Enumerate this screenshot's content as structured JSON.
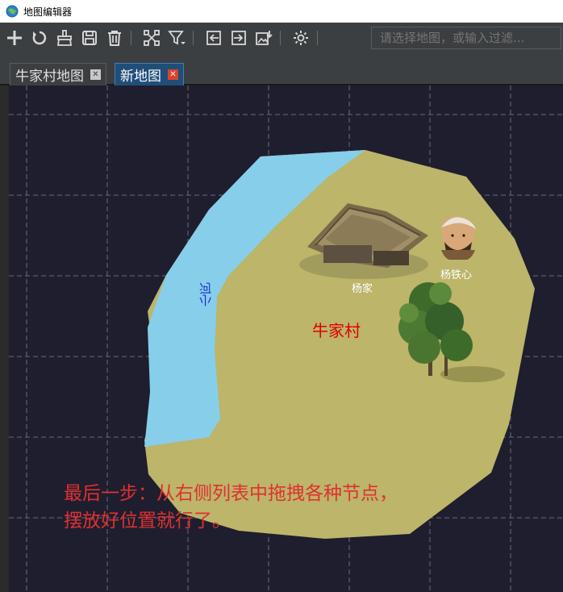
{
  "window": {
    "title": "地图编辑器"
  },
  "toolbar": {
    "search_placeholder": "请选择地图，或输入过滤..."
  },
  "tabs": [
    {
      "label": "牛家村地图",
      "active": false
    },
    {
      "label": "新地图",
      "active": true
    }
  ],
  "map": {
    "river_label": "小河",
    "village_label": "牛家村",
    "house_label": "杨家",
    "npc_label": "杨铁心"
  },
  "annotation": {
    "line1": "最后一步：从右侧列表中拖拽各种节点，",
    "line2": "摆放好位置就行了。"
  },
  "colors": {
    "land": "#bcb56a",
    "river": "#87ceeb",
    "annotation": "#e03030",
    "village_label": "#e00000",
    "river_label": "#1a2cc8"
  }
}
